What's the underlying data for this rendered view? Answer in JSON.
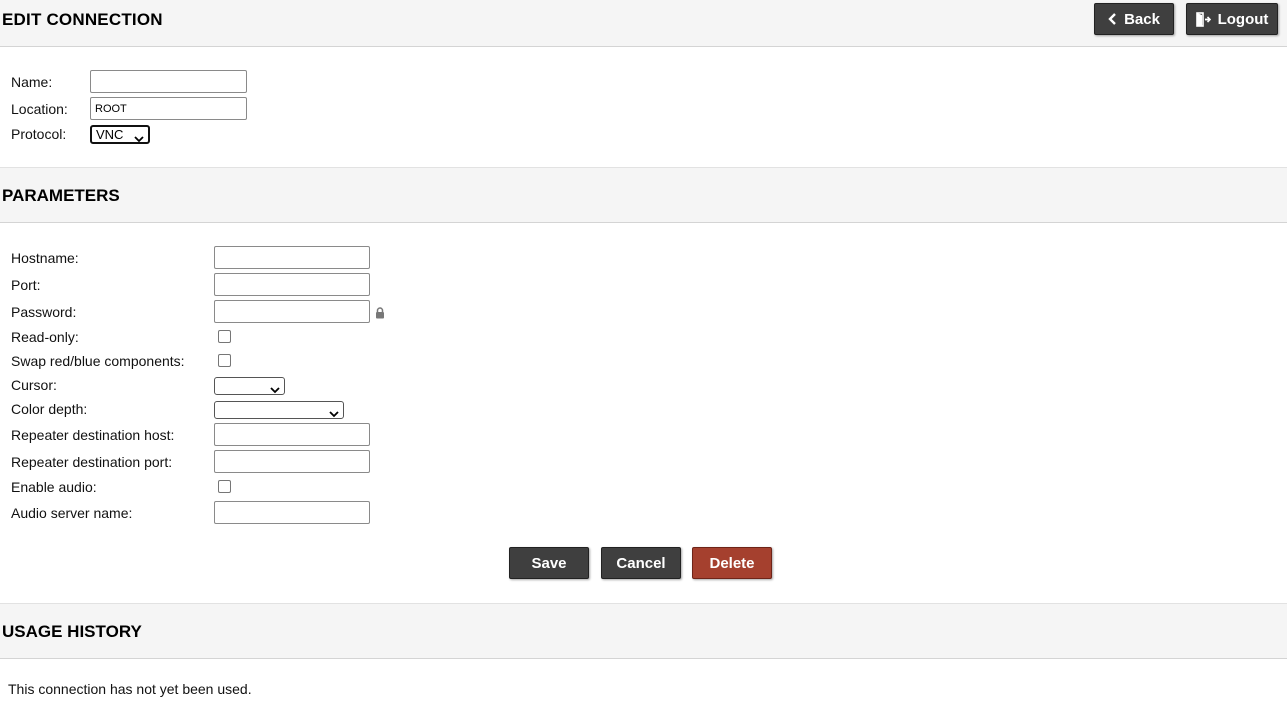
{
  "header": {
    "title": "EDIT CONNECTION",
    "back_label": "Back",
    "logout_label": "Logout"
  },
  "connection": {
    "name_label": "Name:",
    "name_value": "",
    "location_label": "Location:",
    "location_value": "ROOT",
    "protocol_label": "Protocol:",
    "protocol_value": "VNC"
  },
  "parameters": {
    "title": "PARAMETERS",
    "hostname_label": "Hostname:",
    "port_label": "Port:",
    "password_label": "Password:",
    "readonly_label": "Read-only:",
    "swap_label": "Swap red/blue components:",
    "cursor_label": "Cursor:",
    "color_depth_label": "Color depth:",
    "repeater_host_label": "Repeater destination host:",
    "repeater_port_label": "Repeater destination port:",
    "enable_audio_label": "Enable audio:",
    "audio_server_label": "Audio server name:"
  },
  "actions": {
    "save_label": "Save",
    "cancel_label": "Cancel",
    "delete_label": "Delete"
  },
  "history": {
    "title": "USAGE HISTORY",
    "message": "This connection has not yet been used."
  },
  "colors": {
    "button_dark": "#3f3f3f",
    "button_danger": "#a5402e",
    "bar_bg": "#f5f5f5"
  }
}
